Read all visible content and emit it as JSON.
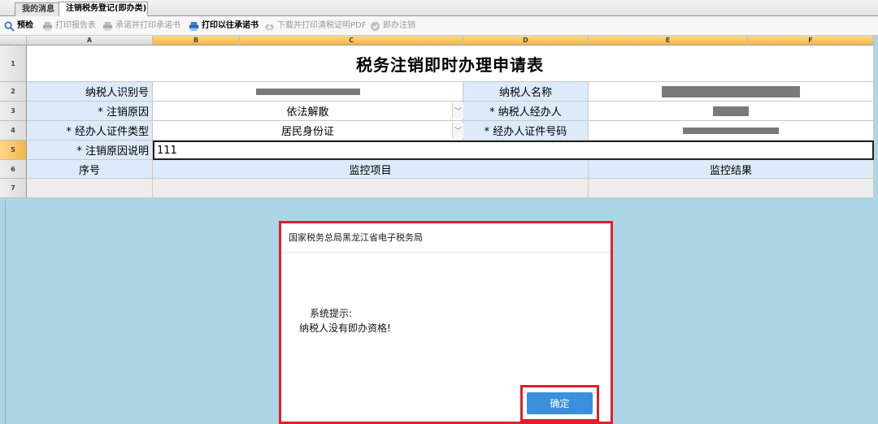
{
  "tabs": [
    {
      "label": "我的消息"
    },
    {
      "label": "注销税务登记(即办类)"
    }
  ],
  "toolbar": [
    {
      "label": "预检",
      "icon": "magnifier-icon",
      "enabled": true
    },
    {
      "label": "打印报告表",
      "icon": "printer-icon",
      "enabled": false
    },
    {
      "label": "承诺并打印承诺书",
      "icon": "printer-icon",
      "enabled": false
    },
    {
      "label": "打印以往承诺书",
      "icon": "printer-icon",
      "enabled": true
    },
    {
      "label": "下载并打印清税证明PDF",
      "icon": "download-icon",
      "enabled": false
    },
    {
      "label": "即办注销",
      "icon": "check-circle-icon",
      "enabled": false
    }
  ],
  "columns": [
    "A",
    "B",
    "C",
    "D",
    "E",
    "F"
  ],
  "rows": [
    "1",
    "2",
    "3",
    "4",
    "5",
    "6",
    "7"
  ],
  "form": {
    "title": "税务注销即时办理申请表",
    "taxpayer_id_label": "纳税人识别号",
    "taxpayer_name_label": "纳税人名称",
    "reason_label": "* 注销原因",
    "reason_value": "依法解散",
    "agent_label": "* 纳税人经办人",
    "id_type_label": "* 经办人证件类型",
    "id_type_value": "居民身份证",
    "id_number_label": "* 经办人证件号码",
    "reason_desc_label": "* 注销原因说明",
    "reason_desc_value": "111",
    "seq_header": "序号",
    "monitor_item_header": "监控项目",
    "monitor_result_header": "监控结果"
  },
  "dialog": {
    "title": "国家税务总局黑龙江省电子税务局",
    "line1": "系统提示:",
    "line2": "纳税人没有即办资格!",
    "ok_label": "确定"
  },
  "colors": {
    "highlight": "#e21e2b",
    "button": "#3c8fdc",
    "label_bg": "#dceaf9",
    "background": "#acd6e6"
  }
}
